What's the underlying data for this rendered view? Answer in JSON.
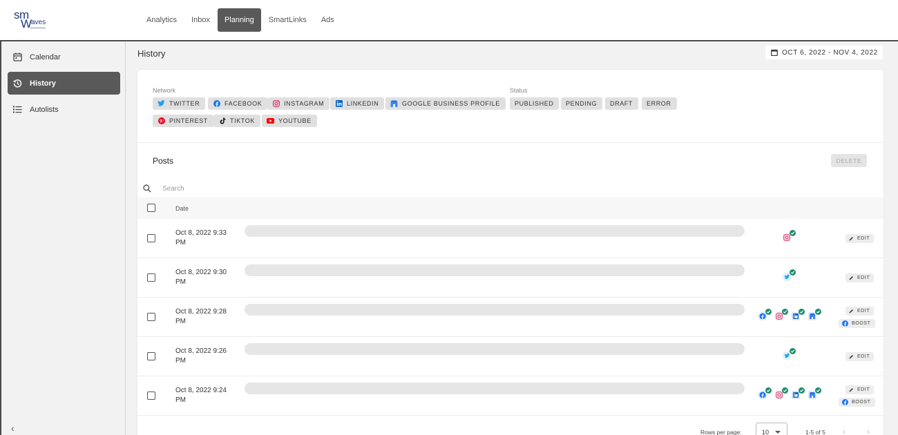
{
  "brand": {
    "logo_line1": "sm",
    "logo_line2_w": "W",
    "logo_line2_rest": "aves"
  },
  "nav": {
    "items": [
      {
        "label": "Analytics",
        "active": false
      },
      {
        "label": "Inbox",
        "active": false
      },
      {
        "label": "Planning",
        "active": true
      },
      {
        "label": "SmartLinks",
        "active": false
      },
      {
        "label": "Ads",
        "active": false
      }
    ]
  },
  "sidebar": {
    "items": [
      {
        "label": "Calendar",
        "icon": "calendar-icon",
        "active": false
      },
      {
        "label": "History",
        "icon": "history-icon",
        "active": true
      },
      {
        "label": "Autolists",
        "icon": "list-icon",
        "active": false
      }
    ],
    "collapse_glyph": "‹"
  },
  "header": {
    "title": "History",
    "date_range": "OCT 6, 2022 - NOV 4, 2022"
  },
  "filters": {
    "network_label": "Network",
    "status_label": "Status",
    "networks": [
      {
        "label": "TWITTER",
        "icon": "twitter-icon",
        "color": "#1da1f2"
      },
      {
        "label": "FACEBOOK",
        "icon": "facebook-icon",
        "color": "#1877f2"
      },
      {
        "label": "INSTAGRAM",
        "icon": "instagram-icon",
        "color": "#e1306c"
      },
      {
        "label": "LINKEDIN",
        "icon": "linkedin-icon",
        "color": "#0a66c2"
      },
      {
        "label": "GOOGLE BUSINESS PROFILE",
        "icon": "google-business-icon",
        "color": "#4285f4"
      },
      {
        "label": "PINTEREST",
        "icon": "pinterest-icon",
        "color": "#e60023"
      },
      {
        "label": "TIKTOK",
        "icon": "tiktok-icon",
        "color": "#111111"
      },
      {
        "label": "YOUTUBE",
        "icon": "youtube-icon",
        "color": "#ff0000"
      }
    ],
    "statuses": [
      {
        "label": "PUBLISHED"
      },
      {
        "label": "PENDING"
      },
      {
        "label": "DRAFT"
      },
      {
        "label": "ERROR"
      }
    ]
  },
  "posts": {
    "title": "Posts",
    "delete_label": "DELETE",
    "search_placeholder": "Search",
    "date_header": "Date",
    "rows": [
      {
        "date_line1": "Oct 8, 2022 9:33",
        "date_line2": "PM",
        "networks": [
          "instagram-icon"
        ],
        "actions": [
          "EDIT"
        ]
      },
      {
        "date_line1": "Oct 8, 2022 9:30",
        "date_line2": "PM",
        "networks": [
          "twitter-icon"
        ],
        "actions": [
          "EDIT"
        ]
      },
      {
        "date_line1": "Oct 8, 2022 9:28",
        "date_line2": "PM",
        "networks": [
          "facebook-icon",
          "instagram-icon",
          "linkedin-icon",
          "google-business-icon"
        ],
        "actions": [
          "EDIT",
          "BOOST"
        ]
      },
      {
        "date_line1": "Oct 8, 2022 9:26",
        "date_line2": "PM",
        "networks": [
          "twitter-icon"
        ],
        "actions": [
          "EDIT"
        ]
      },
      {
        "date_line1": "Oct 8, 2022 9:24",
        "date_line2": "PM",
        "networks": [
          "facebook-icon",
          "instagram-icon",
          "linkedin-icon",
          "google-business-icon"
        ],
        "actions": [
          "EDIT",
          "BOOST"
        ]
      }
    ]
  },
  "pagination": {
    "rows_per_page_label": "Rows per page:",
    "rows_per_page_value": "10",
    "range": "1-5 of 5",
    "prev_glyph": "‹",
    "next_glyph": "›"
  },
  "colors": {
    "accent_dark": "#595959",
    "published_check": "#1e8a6e"
  }
}
